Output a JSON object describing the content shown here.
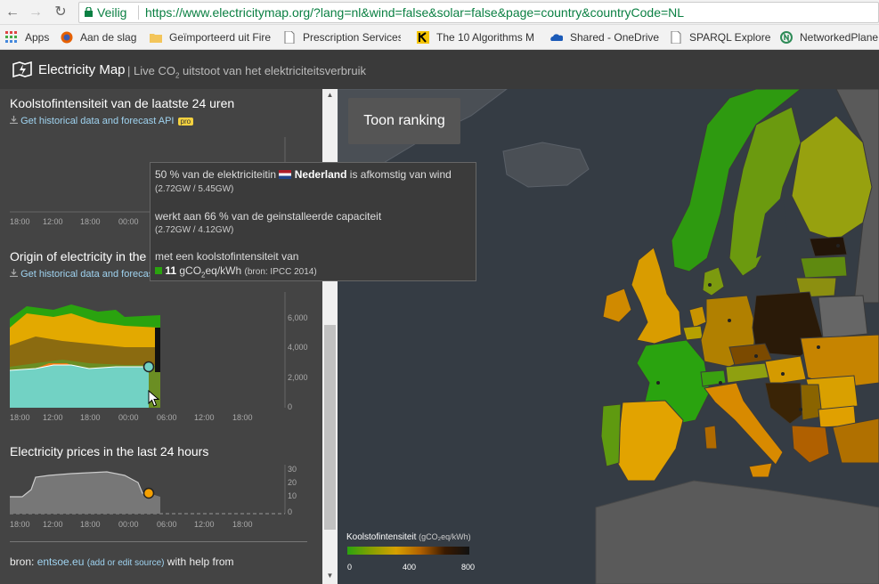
{
  "browser": {
    "secure_label": "Veilig",
    "url": "https://www.electricitymap.org/?lang=nl&wind=false&solar=false&page=country&countryCode=NL",
    "bookmarks": [
      {
        "label": "Apps",
        "icon": "apps-grid-icon"
      },
      {
        "label": "Aan de slag",
        "icon": "firefox-icon"
      },
      {
        "label": "Geïmporteerd uit Fire",
        "icon": "folder-icon"
      },
      {
        "label": "Prescription Services",
        "icon": "page-icon"
      },
      {
        "label": "The 10 Algorithms M",
        "icon": "k-logo-icon"
      },
      {
        "label": "Shared - OneDrive",
        "icon": "onedrive-icon"
      },
      {
        "label": "SPARQL Explorer",
        "icon": "page-icon"
      },
      {
        "label": "NetworkedPlane",
        "icon": "np-logo-icon"
      }
    ]
  },
  "app": {
    "title": "Electricity Map",
    "subtitle_pre": "Live CO",
    "subtitle_sub": "2",
    "subtitle_post": " uitstoot van het elektriciteitsverbruik"
  },
  "sidebar": {
    "carbon_title": "Koolstofintensiteit van de laatste 24 uren",
    "api_link": "Get historical data and forecast API",
    "pro_badge": "pro",
    "carbon_x_ticks": [
      "18:00",
      "12:00",
      "18:00",
      "00:00"
    ],
    "origin_title": "Origin of electricity in the",
    "origin_link": "Get historical data and forecas",
    "origin_y_ticks": [
      "6,000",
      "4,000",
      "2,000",
      "0"
    ],
    "origin_x_ticks": [
      "18:00",
      "12:00",
      "18:00",
      "00:00",
      "06:00",
      "12:00",
      "18:00"
    ],
    "prices_title": "Electricity prices in the last 24 hours",
    "prices_y_ticks": [
      "30",
      "20",
      "10",
      "0"
    ],
    "prices_x_ticks": [
      "18:00",
      "12:00",
      "18:00",
      "00:00",
      "06:00",
      "12:00",
      "18:00"
    ],
    "source_prefix": "bron: ",
    "source_link": "entsoe.eu",
    "source_edit": "(add or edit source)",
    "source_suffix": " with help from"
  },
  "map": {
    "ranking_button": "Toon ranking",
    "legend": {
      "title": "Koolstofintensiteit",
      "unit": "(gCO₂eq/kWh)",
      "ticks": [
        "0",
        "400",
        "800"
      ]
    }
  },
  "tooltip": {
    "line1_pre": "50 % van de elektriciteitin ",
    "country": "Nederland",
    "line1_post": " is afkomstig van wind",
    "line1_detail": "(2.72GW / 5.45GW)",
    "line2": "werkt aan 66 % van de geinstalleerde capaciteit",
    "line2_detail": "(2.72GW / 4.12GW)",
    "line3": "met een koolstofintensiteit van",
    "value": "11",
    "unit_pre": " gCO",
    "unit_sub": "2",
    "unit_post": "eq/kWh",
    "source": "(bron: IPCC 2014)"
  },
  "colors": {
    "sidebar_bg": "#444444",
    "map_bg": "#353c44",
    "wind": "#72d2c4",
    "link": "#9fd3f0"
  }
}
